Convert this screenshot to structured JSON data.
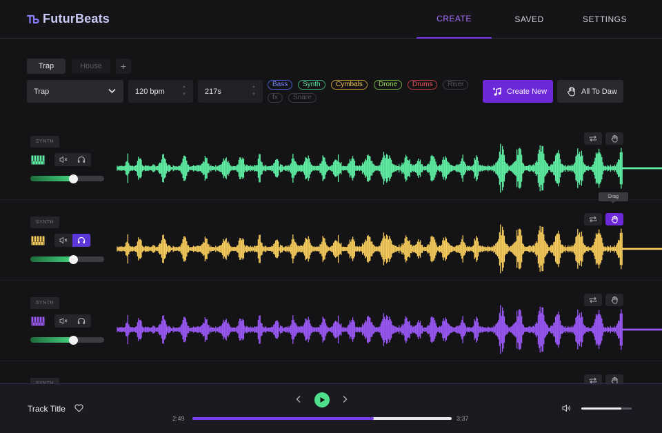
{
  "app": {
    "name": "FuturBeats"
  },
  "nav": [
    {
      "label": "CREATE",
      "active": true
    },
    {
      "label": "SAVED",
      "active": false
    },
    {
      "label": "SETTINGS",
      "active": false
    }
  ],
  "genre_tabs": [
    {
      "label": "Trap",
      "active": true
    },
    {
      "label": "House",
      "active": false
    }
  ],
  "add_tab_label": "+",
  "controls": {
    "genre_select": "Trap",
    "bpm_value": "120 bpm",
    "duration_value": "217s"
  },
  "tags": [
    {
      "label": "Bass",
      "color": "#6f86ff"
    },
    {
      "label": "Synth",
      "color": "#5fe3a5"
    },
    {
      "label": "Cymbals",
      "color": "#f6c75a"
    },
    {
      "label": "Drone",
      "color": "#94e05c"
    },
    {
      "label": "Drums",
      "color": "#f0525a"
    },
    {
      "label": "Riser",
      "color": "#55555c"
    },
    {
      "label": "fx",
      "color": "#55555c"
    },
    {
      "label": "Snare",
      "color": "#55555c"
    }
  ],
  "actions": {
    "create_new": "Create New",
    "all_to_daw": "All To Daw"
  },
  "tracks": [
    {
      "badge": "SYNTH",
      "color": "#5ff0a5",
      "volume": 0.58,
      "solo": false
    },
    {
      "badge": "SYNTH",
      "color": "#f7cc5c",
      "volume": 0.58,
      "solo": true
    },
    {
      "badge": "SYNTH",
      "color": "#9a58f6",
      "volume": 0.58,
      "solo": false
    },
    {
      "badge": "SYNTH",
      "color": "#e04848",
      "volume": 0.58,
      "solo": false
    }
  ],
  "tooltip": {
    "drag": "Drag"
  },
  "player": {
    "title": "Track Title",
    "elapsed": "2:49",
    "total": "3:37",
    "progress": 0.7,
    "volume": 0.8
  },
  "colors": {
    "accent": "#7c3aed",
    "play": "#4ee08a"
  }
}
